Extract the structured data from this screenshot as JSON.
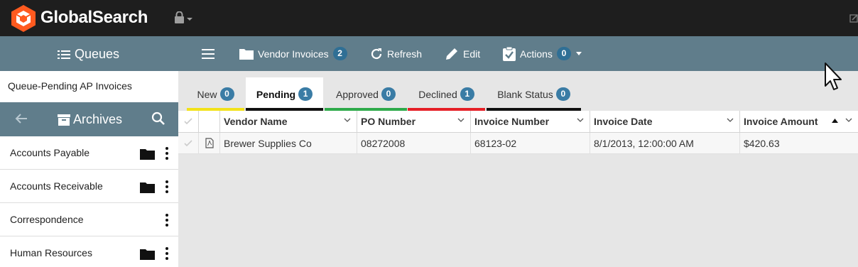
{
  "app": {
    "brand": "GlobalSearch"
  },
  "icons": {
    "logo": "globalsearch-logo-icon",
    "lock": "lock-icon",
    "edit": "edit-icon"
  },
  "sidebar": {
    "queues_title": "Queues",
    "queue_item": "Queue-Pending AP Invoices",
    "archives_title": "Archives",
    "archives": [
      {
        "label": "Accounts Payable",
        "has_folder": true
      },
      {
        "label": "Accounts Receivable",
        "has_folder": true
      },
      {
        "label": "Correspondence",
        "has_folder": false
      },
      {
        "label": "Human Resources",
        "has_folder": true
      }
    ]
  },
  "toolbar": {
    "vendor_invoices": "Vendor Invoices",
    "vendor_invoices_count": "2",
    "refresh": "Refresh",
    "edit": "Edit",
    "actions": "Actions",
    "actions_count": "0"
  },
  "tabs": [
    {
      "label": "New",
      "count": "0",
      "color": "#f2e21a"
    },
    {
      "label": "Pending",
      "count": "1",
      "color": "#111111",
      "active": true
    },
    {
      "label": "Approved",
      "count": "0",
      "color": "#2eaa4a"
    },
    {
      "label": "Declined",
      "count": "1",
      "color": "#e52027"
    },
    {
      "label": "Blank Status",
      "count": "0",
      "color": "#111111"
    }
  ],
  "grid": {
    "columns": [
      "Vendor Name",
      "PO Number",
      "Invoice Number",
      "Invoice Date",
      "Invoice Amount"
    ],
    "rows": [
      [
        "Brewer Supplies Co",
        "08272008",
        "68123-02",
        "8/1/2013, 12:00:00 AM",
        "$420.63"
      ]
    ]
  },
  "colors": {
    "topbar": "#1e1e1e",
    "accent": "#607d8b",
    "badge": "#2f6f95"
  }
}
